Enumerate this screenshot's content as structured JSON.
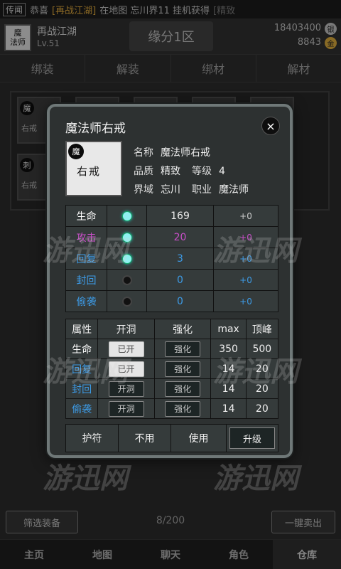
{
  "broadcast": {
    "tag": "传闻",
    "pre": "恭喜",
    "player": "[再战江湖]",
    "mid": "在地图 忘川界11 挂机获得",
    "item": "[精致"
  },
  "header": {
    "avatar_line1": "魔",
    "avatar_line2": "法师",
    "player_name": "再战江湖",
    "level": "Lv.51",
    "server": "缘分1区",
    "silver": "18403400",
    "silver_icon": "银",
    "gold": "8843",
    "gold_icon": "金"
  },
  "tabs": [
    "绑装",
    "解装",
    "绑材",
    "解材"
  ],
  "inventory_bg": {
    "cards": [
      {
        "icon": "魔",
        "text": "右戒"
      },
      {
        "icon": "刺",
        "text": "右戒"
      }
    ],
    "partial_labels": [
      "忘川"
    ]
  },
  "watermark": "游迅网",
  "modal": {
    "title": "魔法师右戒",
    "portrait_icon": "魔",
    "portrait_name": "右戒",
    "info": {
      "name_label": "名称",
      "name_value": "魔法师右戒",
      "quality_label": "品质",
      "quality_value": "精致",
      "level_label": "等级",
      "level_value": "4",
      "realm_label": "界域",
      "realm_value": "忘川",
      "job_label": "职业",
      "job_value": "魔法师"
    },
    "stats": [
      {
        "name": "生命",
        "active": true,
        "value": "169",
        "delta": "+0"
      },
      {
        "name": "攻击",
        "active": true,
        "value": "20",
        "delta": "+0"
      },
      {
        "name": "回复",
        "active": true,
        "value": "3",
        "delta": "+0"
      },
      {
        "name": "封回",
        "active": false,
        "value": "0",
        "delta": "+0"
      },
      {
        "name": "偷袭",
        "active": false,
        "value": "0",
        "delta": "+0"
      }
    ],
    "attr_headers": [
      "属性",
      "开洞",
      "强化",
      "max",
      "顶峰"
    ],
    "attrs": [
      {
        "name": "生命",
        "hole": "已开",
        "enhance": "强化",
        "max": "350",
        "peak": "500"
      },
      {
        "name": "回复",
        "hole": "已开",
        "enhance": "强化",
        "max": "14",
        "peak": "20"
      },
      {
        "name": "封回",
        "hole": "开洞",
        "enhance": "强化",
        "max": "14",
        "peak": "20"
      },
      {
        "name": "偷袭",
        "hole": "开洞",
        "enhance": "强化",
        "max": "14",
        "peak": "20"
      }
    ],
    "amulet": {
      "label": "护符",
      "disable": "不用",
      "use": "使用",
      "upgrade": "升级"
    },
    "close_icon": "×"
  },
  "footer": {
    "filter": "筛选装备",
    "count": "8/200",
    "sell": "一键卖出"
  },
  "nav": [
    "主页",
    "地图",
    "聊天",
    "角色",
    "仓库"
  ],
  "colors": {
    "stat_blue": "#3d9be6",
    "stat_pink": "#c84fc8",
    "bead_active": "#8ff0f0",
    "highlight_gold": "#d9a43a"
  }
}
